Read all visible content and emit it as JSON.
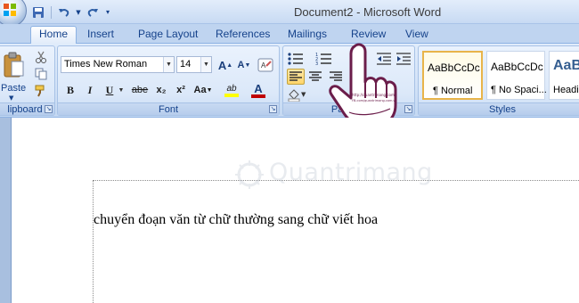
{
  "window": {
    "title": "Document2 - Microsoft Word"
  },
  "quick_access": {
    "items": [
      "save-icon",
      "undo-icon",
      "redo-icon",
      "customize-icon"
    ]
  },
  "tabs": [
    {
      "label": "Home",
      "active": true
    },
    {
      "label": "Insert"
    },
    {
      "label": "Page Layout"
    },
    {
      "label": "References"
    },
    {
      "label": "Mailings"
    },
    {
      "label": "Review"
    },
    {
      "label": "View"
    }
  ],
  "clipboard": {
    "paste_label": "Paste",
    "group_label": "lipboard"
  },
  "font": {
    "font_name": "Times New Roman",
    "font_size": "14",
    "group_label": "Font",
    "bold": "B",
    "italic": "I",
    "underline": "U",
    "strikethrough": "abe",
    "subscript": "x₂",
    "superscript": "x²",
    "change_case": "Aa",
    "grow_font": "A",
    "shrink_font": "A",
    "highlight": "ab",
    "font_color": "A"
  },
  "paragraph": {
    "group_label": "Paragra"
  },
  "styles": {
    "group_label": "Styles",
    "items": [
      {
        "sample": "AaBbCcDc",
        "name": "¶ Normal",
        "active": true
      },
      {
        "sample": "AaBbCcDc",
        "name": "¶ No Spaci..."
      },
      {
        "sample": "AaB",
        "name": "Headin"
      }
    ]
  },
  "document": {
    "text": "chuyển đoạn văn từ chữ thường sang chữ viết hoa"
  },
  "watermark": {
    "text": "Quantrimang"
  },
  "colors": {
    "highlight": "#ffff00",
    "font_color": "#c00000",
    "accent": "#15428b"
  }
}
